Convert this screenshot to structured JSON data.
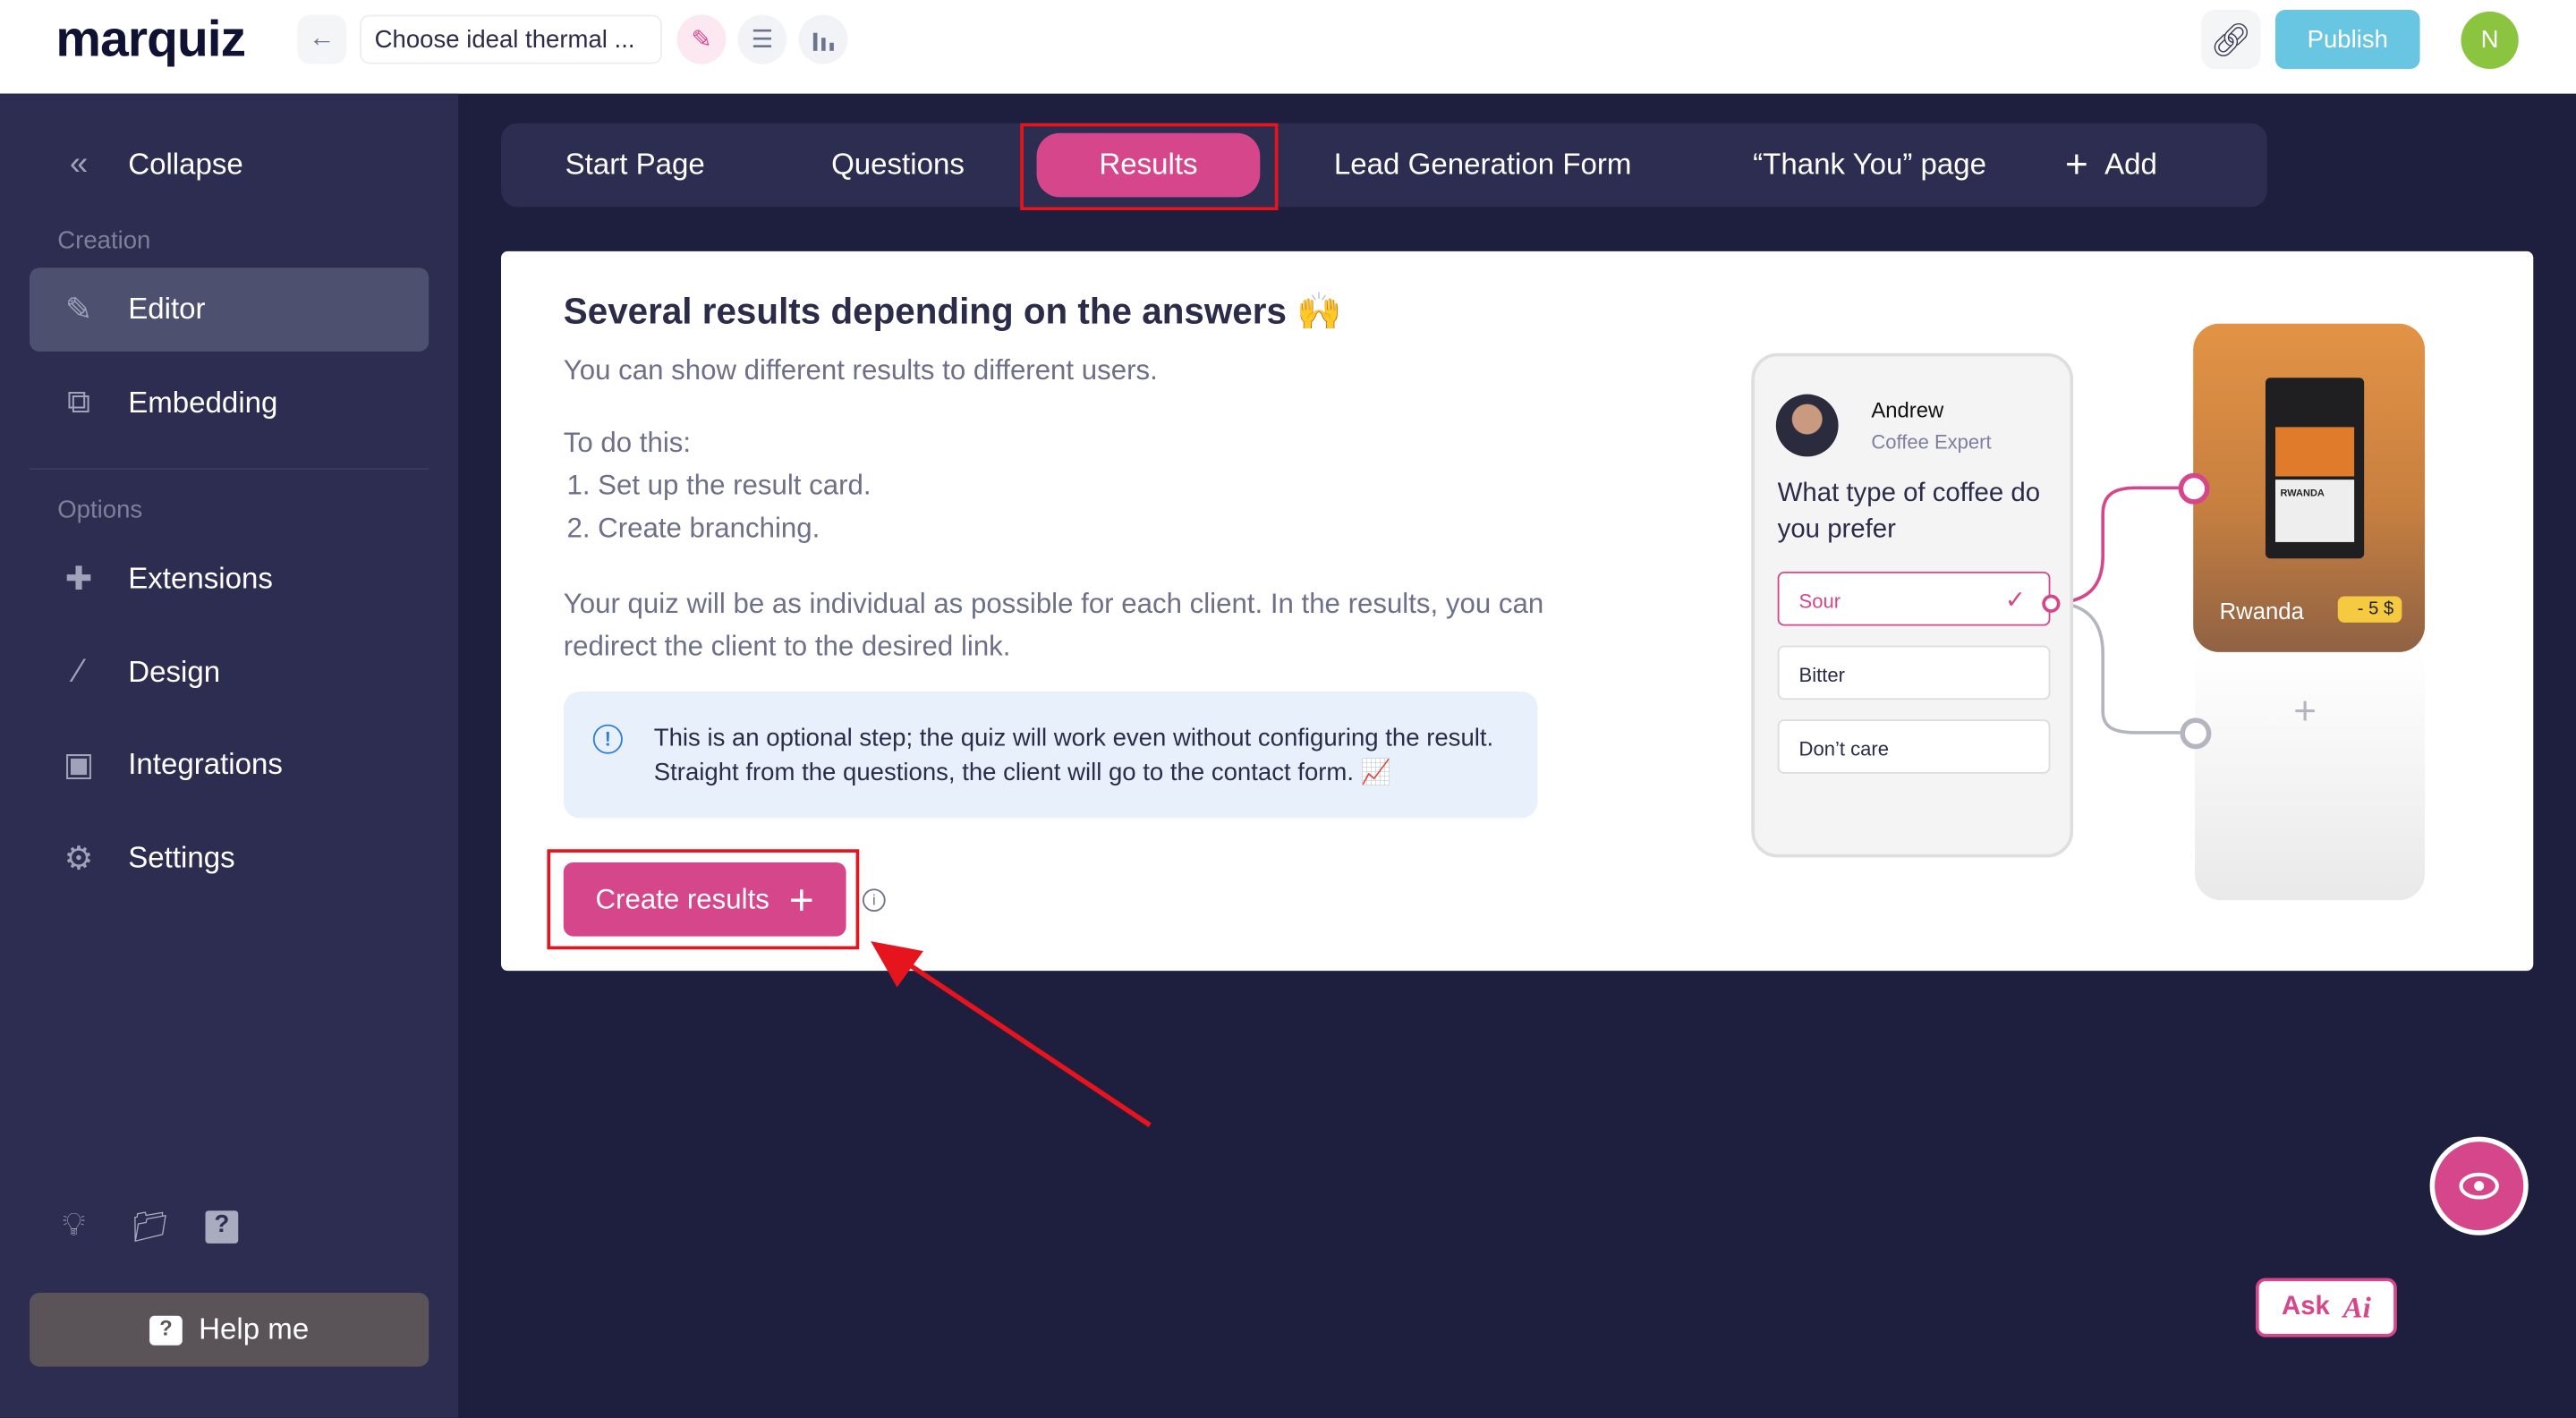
{
  "header": {
    "logo": "marquiz",
    "quiz_title": "Choose ideal thermal ...",
    "publish": "Publish",
    "user_initial": "N",
    "icons": [
      "arrow-left-icon",
      "pencil-icon",
      "list-icon",
      "bar-chart-icon",
      "link-icon"
    ]
  },
  "sidebar": {
    "collapse": "Collapse",
    "section_creation": "Creation",
    "section_options": "Options",
    "items": [
      {
        "label": "Editor",
        "icon": "pencil-icon"
      },
      {
        "label": "Embedding",
        "icon": "embed-icon"
      },
      {
        "label": "Extensions",
        "icon": "puzzle-icon"
      },
      {
        "label": "Design",
        "icon": "brush-icon"
      },
      {
        "label": "Integrations",
        "icon": "integrations-icon"
      },
      {
        "label": "Settings",
        "icon": "gear-icon"
      }
    ],
    "help": "Help me"
  },
  "tabs": [
    {
      "label": "Start Page"
    },
    {
      "label": "Questions"
    },
    {
      "label": "Results"
    },
    {
      "label": "Lead Generation Form"
    },
    {
      "label": "“Thank You” page"
    },
    {
      "label": "Add"
    }
  ],
  "content": {
    "title": "Several results depending on the answers 🙌",
    "subtitle": "You can show different results to different users.",
    "todo": "To do this:",
    "step1": "1. Set up the result card.",
    "step2": "2. Create branching.",
    "paragraph": "Your quiz will be as individual as possible for each client. In the results, you can redirect the client to the desired link.",
    "note": "This is an optional step; the quiz will work even without configuring the result. Straight from the questions, the client will go to the contact form. 📈",
    "create_button": "Create results"
  },
  "illustration": {
    "name": "Andrew",
    "role": "Coffee Expert",
    "question": "What type of coffee do you prefer",
    "options": [
      "Sour",
      "Bitter",
      "Don’t care"
    ],
    "result_name": "Rwanda",
    "result_badge": "- 5 $",
    "bag_label": "RWANDA"
  },
  "floating": {
    "ask": "Ask"
  },
  "colors": {
    "accent": "#d6468a",
    "publish": "#68c6e3",
    "sidebar": "#2c2d50",
    "background": "#1e1f3f",
    "highlight": "#e5141d"
  }
}
